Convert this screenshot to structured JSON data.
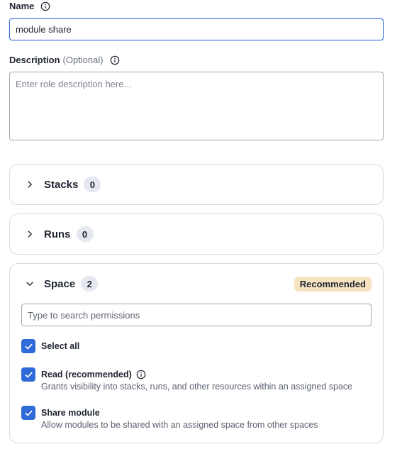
{
  "name_field": {
    "label": "Name",
    "value": "module share"
  },
  "description_field": {
    "label": "Description",
    "optional_label": "(Optional)",
    "placeholder": "Enter role description here..."
  },
  "sections": {
    "stacks": {
      "title": "Stacks",
      "count": "0",
      "expanded": false
    },
    "runs": {
      "title": "Runs",
      "count": "0",
      "expanded": false
    },
    "space": {
      "title": "Space",
      "count": "2",
      "expanded": true,
      "badge": "Recommended",
      "search_placeholder": "Type to search permissions",
      "select_all": {
        "label": "Select all",
        "checked": true
      },
      "permissions": [
        {
          "label": "Read (recommended)",
          "description": "Grants visibility into stacks, runs, and other resources within an assigned space",
          "checked": true
        },
        {
          "label": "Share module",
          "description": "Allow modules to be shared with an assigned space from other spaces",
          "checked": true
        }
      ]
    }
  },
  "colors": {
    "accent": "#2f6bd8",
    "badge_bg": "#f7e3c2",
    "count_bg": "#e6e8ef",
    "border": "#d7dae0"
  }
}
